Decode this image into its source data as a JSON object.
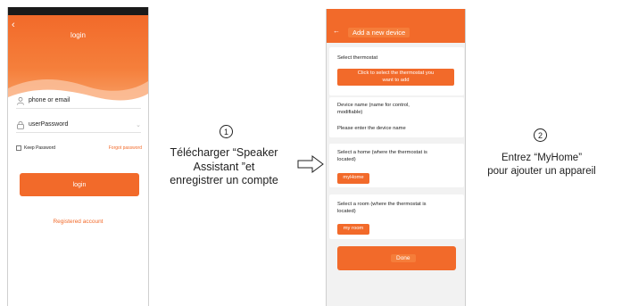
{
  "login_screen": {
    "back_icon": "chevron-left-icon",
    "title": "login",
    "phone_placeholder": "phone or email",
    "password_placeholder": "userPassword",
    "keep_password": "Keep Password",
    "forgot_password": "Forgot password",
    "login_button": "login",
    "register_link": "Registered account",
    "colors": {
      "accent": "#f26a2a",
      "status_bar": "#1a1a1a"
    }
  },
  "step1": {
    "number": "1",
    "line1": "Télécharger “Speaker",
    "line2": "Assistant ”et",
    "line3": "enregistrer un compte"
  },
  "add_device_screen": {
    "back_icon": "arrow-left-icon",
    "title": "Add a new device",
    "select_thermostat_label": "Select thermostat",
    "select_thermostat_button_line1": "Click to select the thermostat you",
    "select_thermostat_button_line2": "want to add",
    "device_name_label_line1": "Device name (name for control,",
    "device_name_label_line2": "modifiable)",
    "device_name_placeholder": "Please enter the device name",
    "home_label_line1": "Select a home (where the thermostat is",
    "home_label_line2": "located)",
    "home_value": "myHome",
    "room_label_line1": "Select a room (where the thermostat is",
    "room_label_line2": "located)",
    "room_value": "my room",
    "done_button": "Done"
  },
  "step2": {
    "number": "2",
    "line1": "Entrez “MyHome”",
    "line2": "pour ajouter un appareil"
  }
}
